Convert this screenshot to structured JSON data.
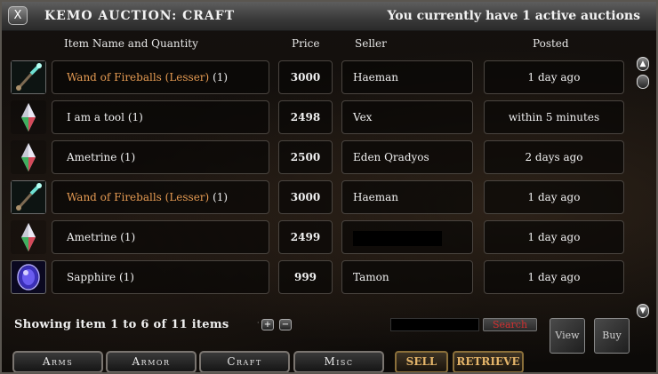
{
  "window": {
    "title": "KEMO AUCTION: CRAFT",
    "status": "You currently have 1 active auctions",
    "close_label": "X"
  },
  "columns": {
    "name": "Item Name and Quantity",
    "price": "Price",
    "seller": "Seller",
    "posted": "Posted"
  },
  "rows": [
    {
      "name": "Wand of Fireballs (Lesser)",
      "qty": "(1)",
      "price": "3000",
      "seller": "Haeman",
      "posted": "1 day ago",
      "icon": "wand-icon",
      "highlight": true
    },
    {
      "name": "I am a tool",
      "qty": "(1)",
      "price": "2498",
      "seller": "Vex",
      "posted": "within 5 minutes",
      "icon": "crystal-icon",
      "highlight": false
    },
    {
      "name": "Ametrine ",
      "qty": "(1)",
      "price": "2500",
      "seller": "Eden Qradyos",
      "posted": "2 days ago",
      "icon": "crystal-icon",
      "highlight": false
    },
    {
      "name": "Wand of Fireballs (Lesser)",
      "qty": "(1)",
      "price": "3000",
      "seller": "Haeman",
      "posted": "1 day ago",
      "icon": "wand-icon",
      "highlight": true
    },
    {
      "name": "Ametrine ",
      "qty": "(1)",
      "price": "2499",
      "seller": "",
      "posted": "1 day ago",
      "icon": "crystal-icon",
      "highlight": false
    },
    {
      "name": "Sapphire",
      "qty": "(1)",
      "price": "999",
      "seller": "Tamon",
      "posted": "1 day ago",
      "icon": "sapphire-icon",
      "highlight": false
    }
  ],
  "footer": {
    "showing": "Showing item 1 to 6 of 11 items",
    "page_prev": "+",
    "page_next": "−",
    "search_value": "",
    "search_label": "Search",
    "view_label": "View",
    "buy_label": "Buy"
  },
  "tabs": [
    {
      "label": "Arms"
    },
    {
      "label": "Armor"
    },
    {
      "label": "Craft"
    },
    {
      "label": "Misc"
    }
  ],
  "actions": {
    "sell_label": "SELL",
    "retrieve_label": "RETRIEVE"
  },
  "colors": {
    "highlight_name": "#e49a52",
    "search_text": "#d23030",
    "action_text": "#e6b66a"
  }
}
